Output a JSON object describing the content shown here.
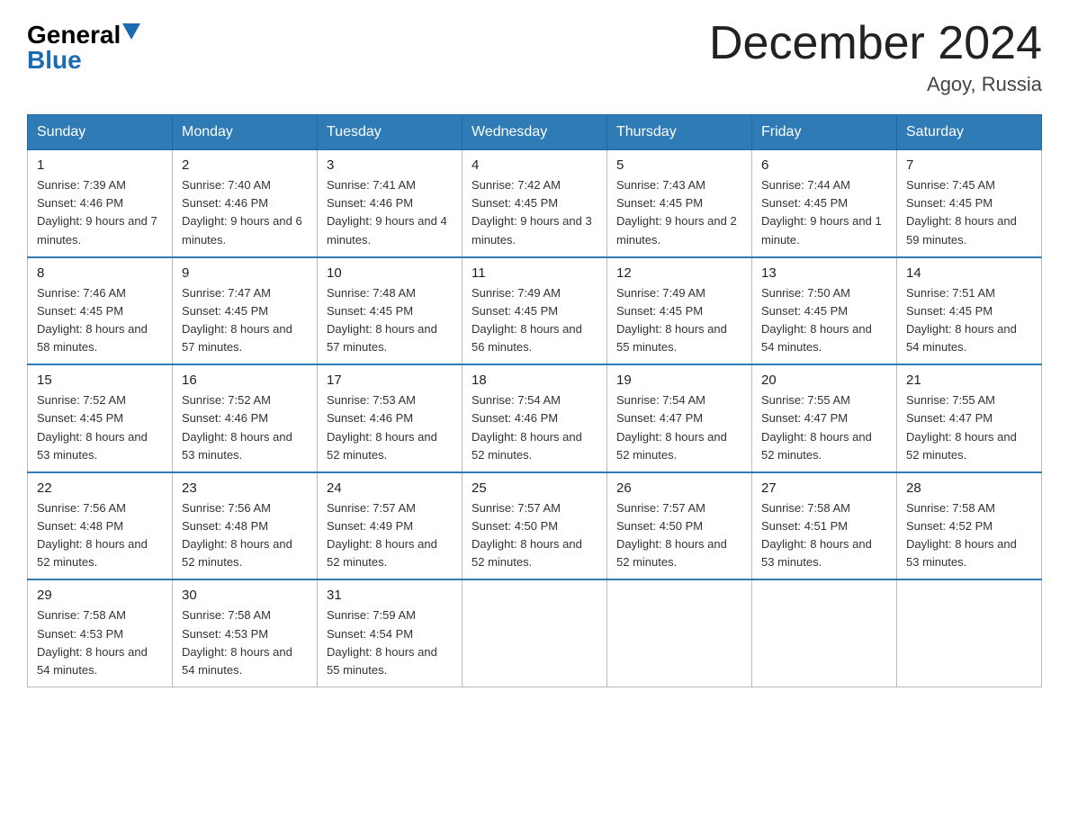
{
  "header": {
    "logo": {
      "general": "General",
      "blue": "Blue"
    },
    "title": "December 2024",
    "location": "Agoy, Russia"
  },
  "weekdays": [
    "Sunday",
    "Monday",
    "Tuesday",
    "Wednesday",
    "Thursday",
    "Friday",
    "Saturday"
  ],
  "weeks": [
    [
      {
        "day": "1",
        "sunrise": "7:39 AM",
        "sunset": "4:46 PM",
        "daylight": "9 hours and 7 minutes."
      },
      {
        "day": "2",
        "sunrise": "7:40 AM",
        "sunset": "4:46 PM",
        "daylight": "9 hours and 6 minutes."
      },
      {
        "day": "3",
        "sunrise": "7:41 AM",
        "sunset": "4:46 PM",
        "daylight": "9 hours and 4 minutes."
      },
      {
        "day": "4",
        "sunrise": "7:42 AM",
        "sunset": "4:45 PM",
        "daylight": "9 hours and 3 minutes."
      },
      {
        "day": "5",
        "sunrise": "7:43 AM",
        "sunset": "4:45 PM",
        "daylight": "9 hours and 2 minutes."
      },
      {
        "day": "6",
        "sunrise": "7:44 AM",
        "sunset": "4:45 PM",
        "daylight": "9 hours and 1 minute."
      },
      {
        "day": "7",
        "sunrise": "7:45 AM",
        "sunset": "4:45 PM",
        "daylight": "8 hours and 59 minutes."
      }
    ],
    [
      {
        "day": "8",
        "sunrise": "7:46 AM",
        "sunset": "4:45 PM",
        "daylight": "8 hours and 58 minutes."
      },
      {
        "day": "9",
        "sunrise": "7:47 AM",
        "sunset": "4:45 PM",
        "daylight": "8 hours and 57 minutes."
      },
      {
        "day": "10",
        "sunrise": "7:48 AM",
        "sunset": "4:45 PM",
        "daylight": "8 hours and 57 minutes."
      },
      {
        "day": "11",
        "sunrise": "7:49 AM",
        "sunset": "4:45 PM",
        "daylight": "8 hours and 56 minutes."
      },
      {
        "day": "12",
        "sunrise": "7:49 AM",
        "sunset": "4:45 PM",
        "daylight": "8 hours and 55 minutes."
      },
      {
        "day": "13",
        "sunrise": "7:50 AM",
        "sunset": "4:45 PM",
        "daylight": "8 hours and 54 minutes."
      },
      {
        "day": "14",
        "sunrise": "7:51 AM",
        "sunset": "4:45 PM",
        "daylight": "8 hours and 54 minutes."
      }
    ],
    [
      {
        "day": "15",
        "sunrise": "7:52 AM",
        "sunset": "4:45 PM",
        "daylight": "8 hours and 53 minutes."
      },
      {
        "day": "16",
        "sunrise": "7:52 AM",
        "sunset": "4:46 PM",
        "daylight": "8 hours and 53 minutes."
      },
      {
        "day": "17",
        "sunrise": "7:53 AM",
        "sunset": "4:46 PM",
        "daylight": "8 hours and 52 minutes."
      },
      {
        "day": "18",
        "sunrise": "7:54 AM",
        "sunset": "4:46 PM",
        "daylight": "8 hours and 52 minutes."
      },
      {
        "day": "19",
        "sunrise": "7:54 AM",
        "sunset": "4:47 PM",
        "daylight": "8 hours and 52 minutes."
      },
      {
        "day": "20",
        "sunrise": "7:55 AM",
        "sunset": "4:47 PM",
        "daylight": "8 hours and 52 minutes."
      },
      {
        "day": "21",
        "sunrise": "7:55 AM",
        "sunset": "4:47 PM",
        "daylight": "8 hours and 52 minutes."
      }
    ],
    [
      {
        "day": "22",
        "sunrise": "7:56 AM",
        "sunset": "4:48 PM",
        "daylight": "8 hours and 52 minutes."
      },
      {
        "day": "23",
        "sunrise": "7:56 AM",
        "sunset": "4:48 PM",
        "daylight": "8 hours and 52 minutes."
      },
      {
        "day": "24",
        "sunrise": "7:57 AM",
        "sunset": "4:49 PM",
        "daylight": "8 hours and 52 minutes."
      },
      {
        "day": "25",
        "sunrise": "7:57 AM",
        "sunset": "4:50 PM",
        "daylight": "8 hours and 52 minutes."
      },
      {
        "day": "26",
        "sunrise": "7:57 AM",
        "sunset": "4:50 PM",
        "daylight": "8 hours and 52 minutes."
      },
      {
        "day": "27",
        "sunrise": "7:58 AM",
        "sunset": "4:51 PM",
        "daylight": "8 hours and 53 minutes."
      },
      {
        "day": "28",
        "sunrise": "7:58 AM",
        "sunset": "4:52 PM",
        "daylight": "8 hours and 53 minutes."
      }
    ],
    [
      {
        "day": "29",
        "sunrise": "7:58 AM",
        "sunset": "4:53 PM",
        "daylight": "8 hours and 54 minutes."
      },
      {
        "day": "30",
        "sunrise": "7:58 AM",
        "sunset": "4:53 PM",
        "daylight": "8 hours and 54 minutes."
      },
      {
        "day": "31",
        "sunrise": "7:59 AM",
        "sunset": "4:54 PM",
        "daylight": "8 hours and 55 minutes."
      },
      null,
      null,
      null,
      null
    ]
  ],
  "labels": {
    "sunrise": "Sunrise:",
    "sunset": "Sunset:",
    "daylight": "Daylight:"
  }
}
